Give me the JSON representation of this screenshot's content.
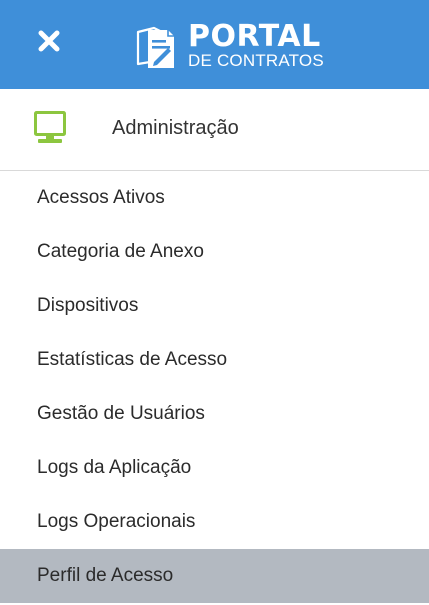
{
  "header": {
    "close_icon": "close-icon",
    "logo_icon": "document-pen-icon",
    "logo_title": "PORTAL",
    "logo_subtitle": "DE CONTRATOS",
    "background_color": "#3f8fd9"
  },
  "section": {
    "icon": "monitor-icon",
    "icon_color": "#8cc63f",
    "label": "Administração"
  },
  "menu": {
    "items": [
      {
        "label": "Acessos Ativos",
        "active": false
      },
      {
        "label": "Categoria de Anexo",
        "active": false
      },
      {
        "label": "Dispositivos",
        "active": false
      },
      {
        "label": "Estatísticas de Acesso",
        "active": false
      },
      {
        "label": "Gestão de Usuários",
        "active": false
      },
      {
        "label": "Logs da Aplicação",
        "active": false
      },
      {
        "label": "Logs Operacionais",
        "active": false
      },
      {
        "label": "Perfil de Acesso",
        "active": true
      }
    ],
    "active_color": "#b3b9c1"
  }
}
